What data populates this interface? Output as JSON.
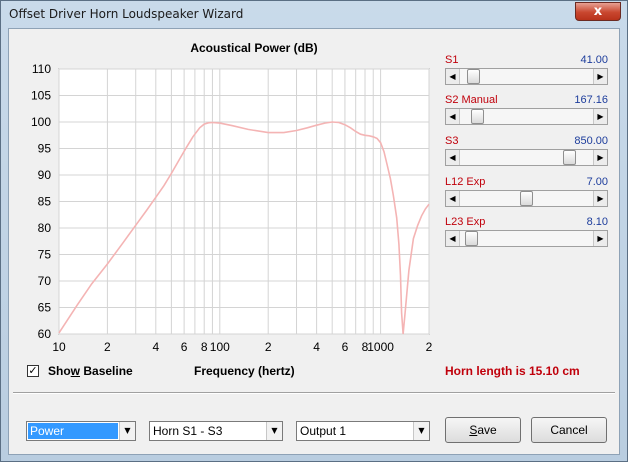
{
  "window": {
    "title": "Offset Driver Horn Loudspeaker Wizard",
    "close_glyph": "x"
  },
  "chart_data": {
    "type": "line",
    "title": "Acoustical Power (dB)",
    "xlabel": "Frequency (hertz)",
    "ylabel": "",
    "x_scale": "log",
    "xlim": [
      10,
      2000
    ],
    "ylim": [
      60,
      110
    ],
    "grid": true,
    "y_ticks": [
      "110",
      "105",
      "100",
      "95",
      "90",
      "85",
      "80",
      "75",
      "70",
      "65",
      "60"
    ],
    "x_tick_values": [
      10,
      20,
      40,
      60,
      80,
      100,
      200,
      400,
      600,
      800,
      1000,
      2000
    ],
    "x_tick_labels": [
      "10",
      "2",
      "4",
      "6",
      "8",
      "100",
      "2",
      "4",
      "6",
      "8",
      "1000",
      "2"
    ],
    "line_color": "#f4b4b4",
    "series": [
      {
        "x": [
          10,
          13,
          16,
          20,
          25,
          30,
          35,
          40,
          45,
          50,
          56,
          62,
          68,
          75,
          80,
          85,
          90,
          100,
          120,
          150,
          200,
          250,
          300,
          350,
          400,
          450,
          500,
          550,
          600,
          650,
          700,
          750,
          800,
          850,
          900,
          950,
          1000,
          1050,
          1100,
          1150,
          1200,
          1260,
          1300,
          1330,
          1350,
          1380,
          1420,
          1500,
          1600,
          1700,
          1800,
          1900,
          2000
        ],
        "y": [
          60.2,
          65.5,
          69.5,
          73.2,
          77.2,
          80.5,
          83.3,
          85.8,
          88.0,
          90.3,
          92.9,
          95.2,
          97.2,
          98.9,
          99.6,
          99.85,
          99.9,
          99.8,
          99.3,
          98.6,
          98.0,
          98.0,
          98.4,
          98.9,
          99.4,
          99.8,
          100.0,
          99.9,
          99.5,
          98.9,
          98.2,
          97.7,
          97.5,
          97.4,
          97.2,
          96.9,
          96.1,
          94.4,
          91.8,
          89.3,
          86.2,
          81.9,
          77.0,
          71.0,
          64.0,
          60.0,
          64.0,
          72.0,
          78.0,
          80.5,
          82.3,
          83.6,
          84.5
        ]
      }
    ]
  },
  "params": [
    {
      "label": "S1",
      "value": "41.00",
      "thumb": 0.06
    },
    {
      "label": "S2  Manual",
      "value": "167.16",
      "thumb": 0.09
    },
    {
      "label": "S3",
      "value": "850.00",
      "thumb": 0.86
    },
    {
      "label": "L12  Exp",
      "value": "7.00",
      "thumb": 0.5
    },
    {
      "label": "L23  Exp",
      "value": "8.10",
      "thumb": 0.04
    }
  ],
  "show_baseline": {
    "checked": true,
    "check_glyph": "✓",
    "label_pre": "Sho",
    "label_accel": "w",
    "label_post": " Baseline"
  },
  "horn_length": "Horn length is 15.10 cm",
  "dropdowns": {
    "measure": "Power",
    "section": "Horn S1 - S3",
    "output": "Output 1",
    "arrow_glyph": "▼"
  },
  "buttons": {
    "save_accel": "S",
    "save_rest": "ave",
    "cancel": "Cancel"
  },
  "scroll_arrows": {
    "left": "◀",
    "right": "▶"
  }
}
